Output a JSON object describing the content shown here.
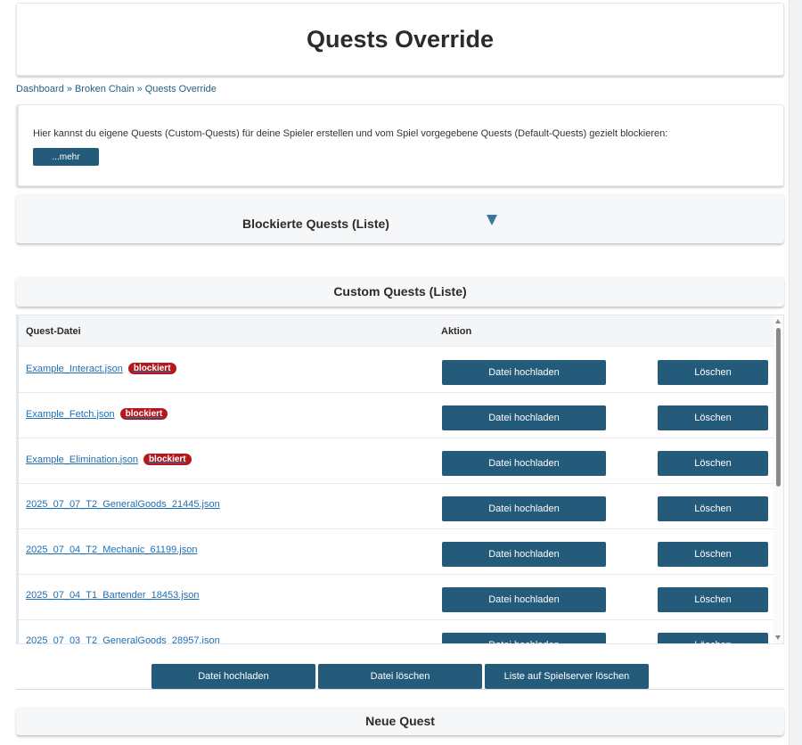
{
  "page_title": "Quests Override",
  "breadcrumb": {
    "items": [
      "Dashboard",
      "Broken Chain",
      "Quests Override"
    ],
    "separator": "»"
  },
  "info": {
    "text": "Hier kannst du eigene Quests (Custom-Quests) für deine Spieler erstellen und vom Spiel vorgegebene Quests (Default-Quests) gezielt blockieren:",
    "more_label": "...mehr"
  },
  "blocked_section": {
    "title": "Blockierte Quests (Liste)",
    "toggle_icon": "triangle-down-icon"
  },
  "custom_section": {
    "title": "Custom Quests (Liste)",
    "columns": [
      "Quest-Datei",
      "Aktion"
    ],
    "upload_label": "Datei hochladen",
    "delete_label": "Löschen",
    "blocked_badge": "blockiert",
    "rows": [
      {
        "file": "Example_Interact.json",
        "blocked": true
      },
      {
        "file": "Example_Fetch.json",
        "blocked": true
      },
      {
        "file": "Example_Elimination.json",
        "blocked": true
      },
      {
        "file": "2025_07_07_T2_GeneralGoods_21445.json",
        "blocked": false
      },
      {
        "file": "2025_07_04_T2_Mechanic_61199.json",
        "blocked": false
      },
      {
        "file": "2025_07_04_T1_Bartender_18453.json",
        "blocked": false
      },
      {
        "file": "2025_07_03_T2_GeneralGoods_28957.json",
        "blocked": false
      }
    ]
  },
  "action_bar": {
    "upload": "Datei hochladen",
    "delete": "Datei löschen",
    "delete_server": "Liste auf Spielserver löschen"
  },
  "new_quest_section": {
    "title": "Neue Quest"
  },
  "colors": {
    "button": "#245b7a",
    "link": "#1f6fb3",
    "badge": "#b4181f",
    "section_bg": "#f5f7f9"
  }
}
